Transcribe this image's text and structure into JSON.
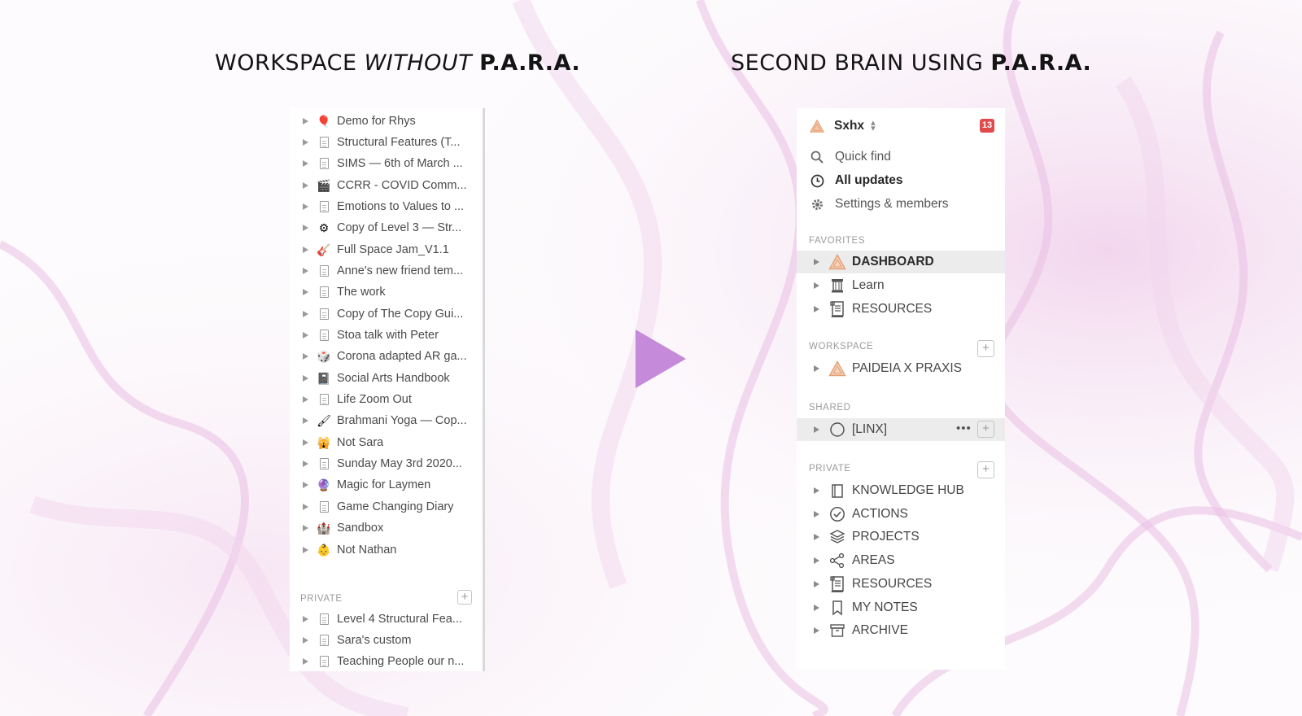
{
  "left": {
    "heading_prefix": "WORKSPACE ",
    "heading_italic": "WITHOUT",
    "heading_bold": "P.A.R.A.",
    "items": [
      {
        "label": "Demo for Rhys",
        "icon": "balloon-icon",
        "glyph": "🎈"
      },
      {
        "label": "Structural Features (T...",
        "icon": "page-icon"
      },
      {
        "label": "SIMS — 6th of March ...",
        "icon": "page-icon"
      },
      {
        "label": "CCRR - COVID Comm...",
        "icon": "clapperboard-icon",
        "glyph": "🎬"
      },
      {
        "label": "Emotions to Values to ...",
        "icon": "page-icon"
      },
      {
        "label": "Copy of Level 3 — Str...",
        "icon": "gear-icon",
        "glyph": "⚙"
      },
      {
        "label": "Full Space Jam_V1.1",
        "icon": "guitar-icon",
        "glyph": "🎸"
      },
      {
        "label": "Anne's new friend tem...",
        "icon": "page-icon"
      },
      {
        "label": "The work",
        "icon": "page-icon"
      },
      {
        "label": "Copy of The Copy Gui...",
        "icon": "page-icon"
      },
      {
        "label": "Stoa talk with Peter",
        "icon": "page-icon"
      },
      {
        "label": "Corona adapted AR ga...",
        "icon": "dice-icon",
        "glyph": "🎲"
      },
      {
        "label": "Social Arts Handbook",
        "icon": "notebook-icon",
        "glyph": "📓"
      },
      {
        "label": "Life Zoom Out",
        "icon": "page-icon"
      },
      {
        "label": "Brahmani Yoga — Cop...",
        "icon": "brush-icon",
        "glyph": "🖌"
      },
      {
        "label": "Not Sara",
        "icon": "face-icon",
        "glyph": "🙀"
      },
      {
        "label": "Sunday May 3rd 2020...",
        "icon": "page-icon"
      },
      {
        "label": "Magic for Laymen",
        "icon": "crystal-ball-icon",
        "glyph": "🔮"
      },
      {
        "label": "Game Changing Diary",
        "icon": "page-icon"
      },
      {
        "label": "Sandbox",
        "icon": "castle-icon",
        "glyph": "🏰"
      },
      {
        "label": "Not Nathan",
        "icon": "baby-face-icon",
        "glyph": "👶"
      }
    ],
    "private_label": "PRIVATE",
    "private_items": [
      {
        "label": "Level 4 Structural Fea...",
        "icon": "page-icon"
      },
      {
        "label": "Sara's custom",
        "icon": "page-icon"
      },
      {
        "label": "Teaching People our n...",
        "icon": "page-icon"
      }
    ]
  },
  "right": {
    "heading_prefix": "SECOND BRAIN USING ",
    "heading_bold": "P.A.R.A.",
    "workspace_name": "Sxhx",
    "badge": "13",
    "menu": [
      {
        "label": "Quick find",
        "icon": "search-icon"
      },
      {
        "label": "All updates",
        "icon": "clock-icon"
      },
      {
        "label": "Settings & members",
        "icon": "gear-icon"
      }
    ],
    "favorites_label": "FAVORITES",
    "favorites": [
      {
        "label": "DASHBOARD",
        "icon": "triangle-logo-icon"
      },
      {
        "label": "Learn",
        "icon": "column-icon"
      },
      {
        "label": "RESOURCES",
        "icon": "scroll-icon"
      }
    ],
    "workspace_label": "WORKSPACE",
    "workspace_items": [
      {
        "label": "PAIDEIA X PRAXIS",
        "icon": "triangle-logo-icon"
      }
    ],
    "shared_label": "SHARED",
    "shared_items": [
      {
        "label": "[LINX]",
        "icon": "circle-icon"
      }
    ],
    "private_label": "PRIVATE",
    "private_items": [
      {
        "label": "KNOWLEDGE HUB",
        "icon": "book-icon"
      },
      {
        "label": "ACTIONS",
        "icon": "check-circle-icon"
      },
      {
        "label": "PROJECTS",
        "icon": "layers-icon"
      },
      {
        "label": "AREAS",
        "icon": "share-nodes-icon"
      },
      {
        "label": "RESOURCES",
        "icon": "scroll-icon"
      },
      {
        "label": "MY NOTES",
        "icon": "bookmark-icon"
      },
      {
        "label": "ARCHIVE",
        "icon": "archive-box-icon"
      }
    ]
  },
  "colors": {
    "accent": "#c58ad9",
    "badge": "#e24b4b"
  }
}
